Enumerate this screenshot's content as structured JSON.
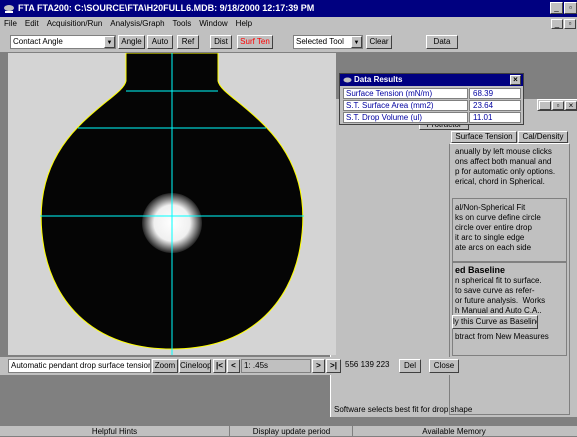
{
  "window": {
    "title": "FTA FTA200: C:\\SOURCE\\FTA\\H20FULL6.MDB: 9/18/2000 12:17:39 PM"
  },
  "menu": [
    "File",
    "Edit",
    "Acquisition/Run",
    "Analysis/Graph",
    "Tools",
    "Window",
    "Help"
  ],
  "toolbar": {
    "mode_select": "Contact Angle",
    "angle": "Angle",
    "auto": "Auto",
    "ref": "Ref",
    "dist": "Dist",
    "surf_ten": "Surf Ten",
    "tool_select": "Selected Tool",
    "clear": "Clear",
    "data": "Data"
  },
  "results": {
    "title": "Data Results",
    "rows": [
      {
        "label": "Surface Tension (mN/m)",
        "value": "68.39"
      },
      {
        "label": "S.T. Surface Area (mm2)",
        "value": "23.64"
      },
      {
        "label": "S.T. Drop Volume (ul)",
        "value": "11.01"
      }
    ]
  },
  "panel": {
    "tab_top": "Protractor",
    "tab_surface": "Surface Tension",
    "tab_density": "Cal/Density",
    "text_top": "anually by left mouse clicks\nons affect both manual and\np for automatic only options.\nerical, chord in Spherical.",
    "text_mid": "al/Non-Spherical Fit\nks on curve define circle\ncircle over entire drop\nit arc to single edge\nate arcs on each side",
    "baseline_title": "ed Baseline",
    "text_baseline": "n spherical fit to surface.\nto save curve as refer-\nor future analysis.  Works\nh Manual and Auto C.A..",
    "baseline_button": "ly this Curve as Baseline",
    "subtract_text": "btract from New Measures",
    "hint": "Software selects best fit for drop shape"
  },
  "bottom_toolbar": {
    "mode_text": "Automatic pendant drop surface tension",
    "zoom": "Zoom",
    "cineloop": "Cineloop",
    "first": "|<",
    "prev": "<",
    "frame": "1: .45s",
    "next": ">",
    "last": ">|",
    "coords": "556 139 223",
    "del": "Del",
    "close": "Close"
  },
  "statusbar": [
    "Helpful Hints",
    "Display update period",
    "Available Memory"
  ],
  "colors": {
    "titlebar": "#000080",
    "surf_ten_text": "#ff0000",
    "crosshair": "#00ffff",
    "drop_outline": "#ffff00"
  }
}
